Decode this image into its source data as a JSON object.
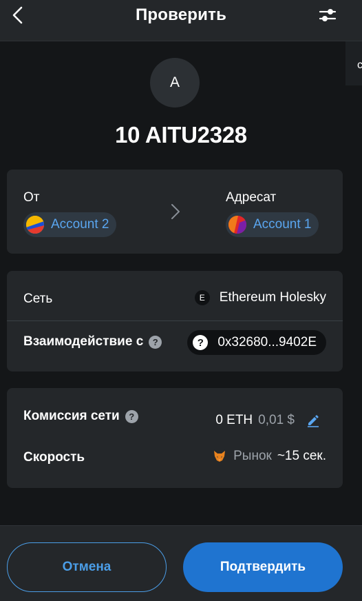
{
  "header": {
    "title": "Проверить"
  },
  "edge": {
    "char": "с"
  },
  "token": {
    "avatar_letter": "A",
    "amount": "10 AITU2328"
  },
  "accounts": {
    "from_label": "От",
    "from_account": "Account 2",
    "to_label": "Адресат",
    "to_account": "Account 1"
  },
  "network": {
    "label": "Сеть",
    "icon_letter": "E",
    "name": "Ethereum Holesky",
    "interaction_label": "Взаимодействие с",
    "info_glyph": "?",
    "contract_glyph": "?",
    "contract_address": "0x32680...9402E"
  },
  "fee": {
    "label": "Комиссия сети",
    "info_glyph": "?",
    "eth_value": "0 ETH",
    "usd_value": "0,01 $",
    "speed_label": "Скорость",
    "speed_type": "Рынок",
    "speed_time": "~15 сек."
  },
  "footer": {
    "cancel_label": "Отмена",
    "confirm_label": "Подтвердить"
  },
  "colors": {
    "accent": "#1f74d0",
    "link": "#5aa6f0",
    "card": "#24272a",
    "background": "#141618"
  }
}
